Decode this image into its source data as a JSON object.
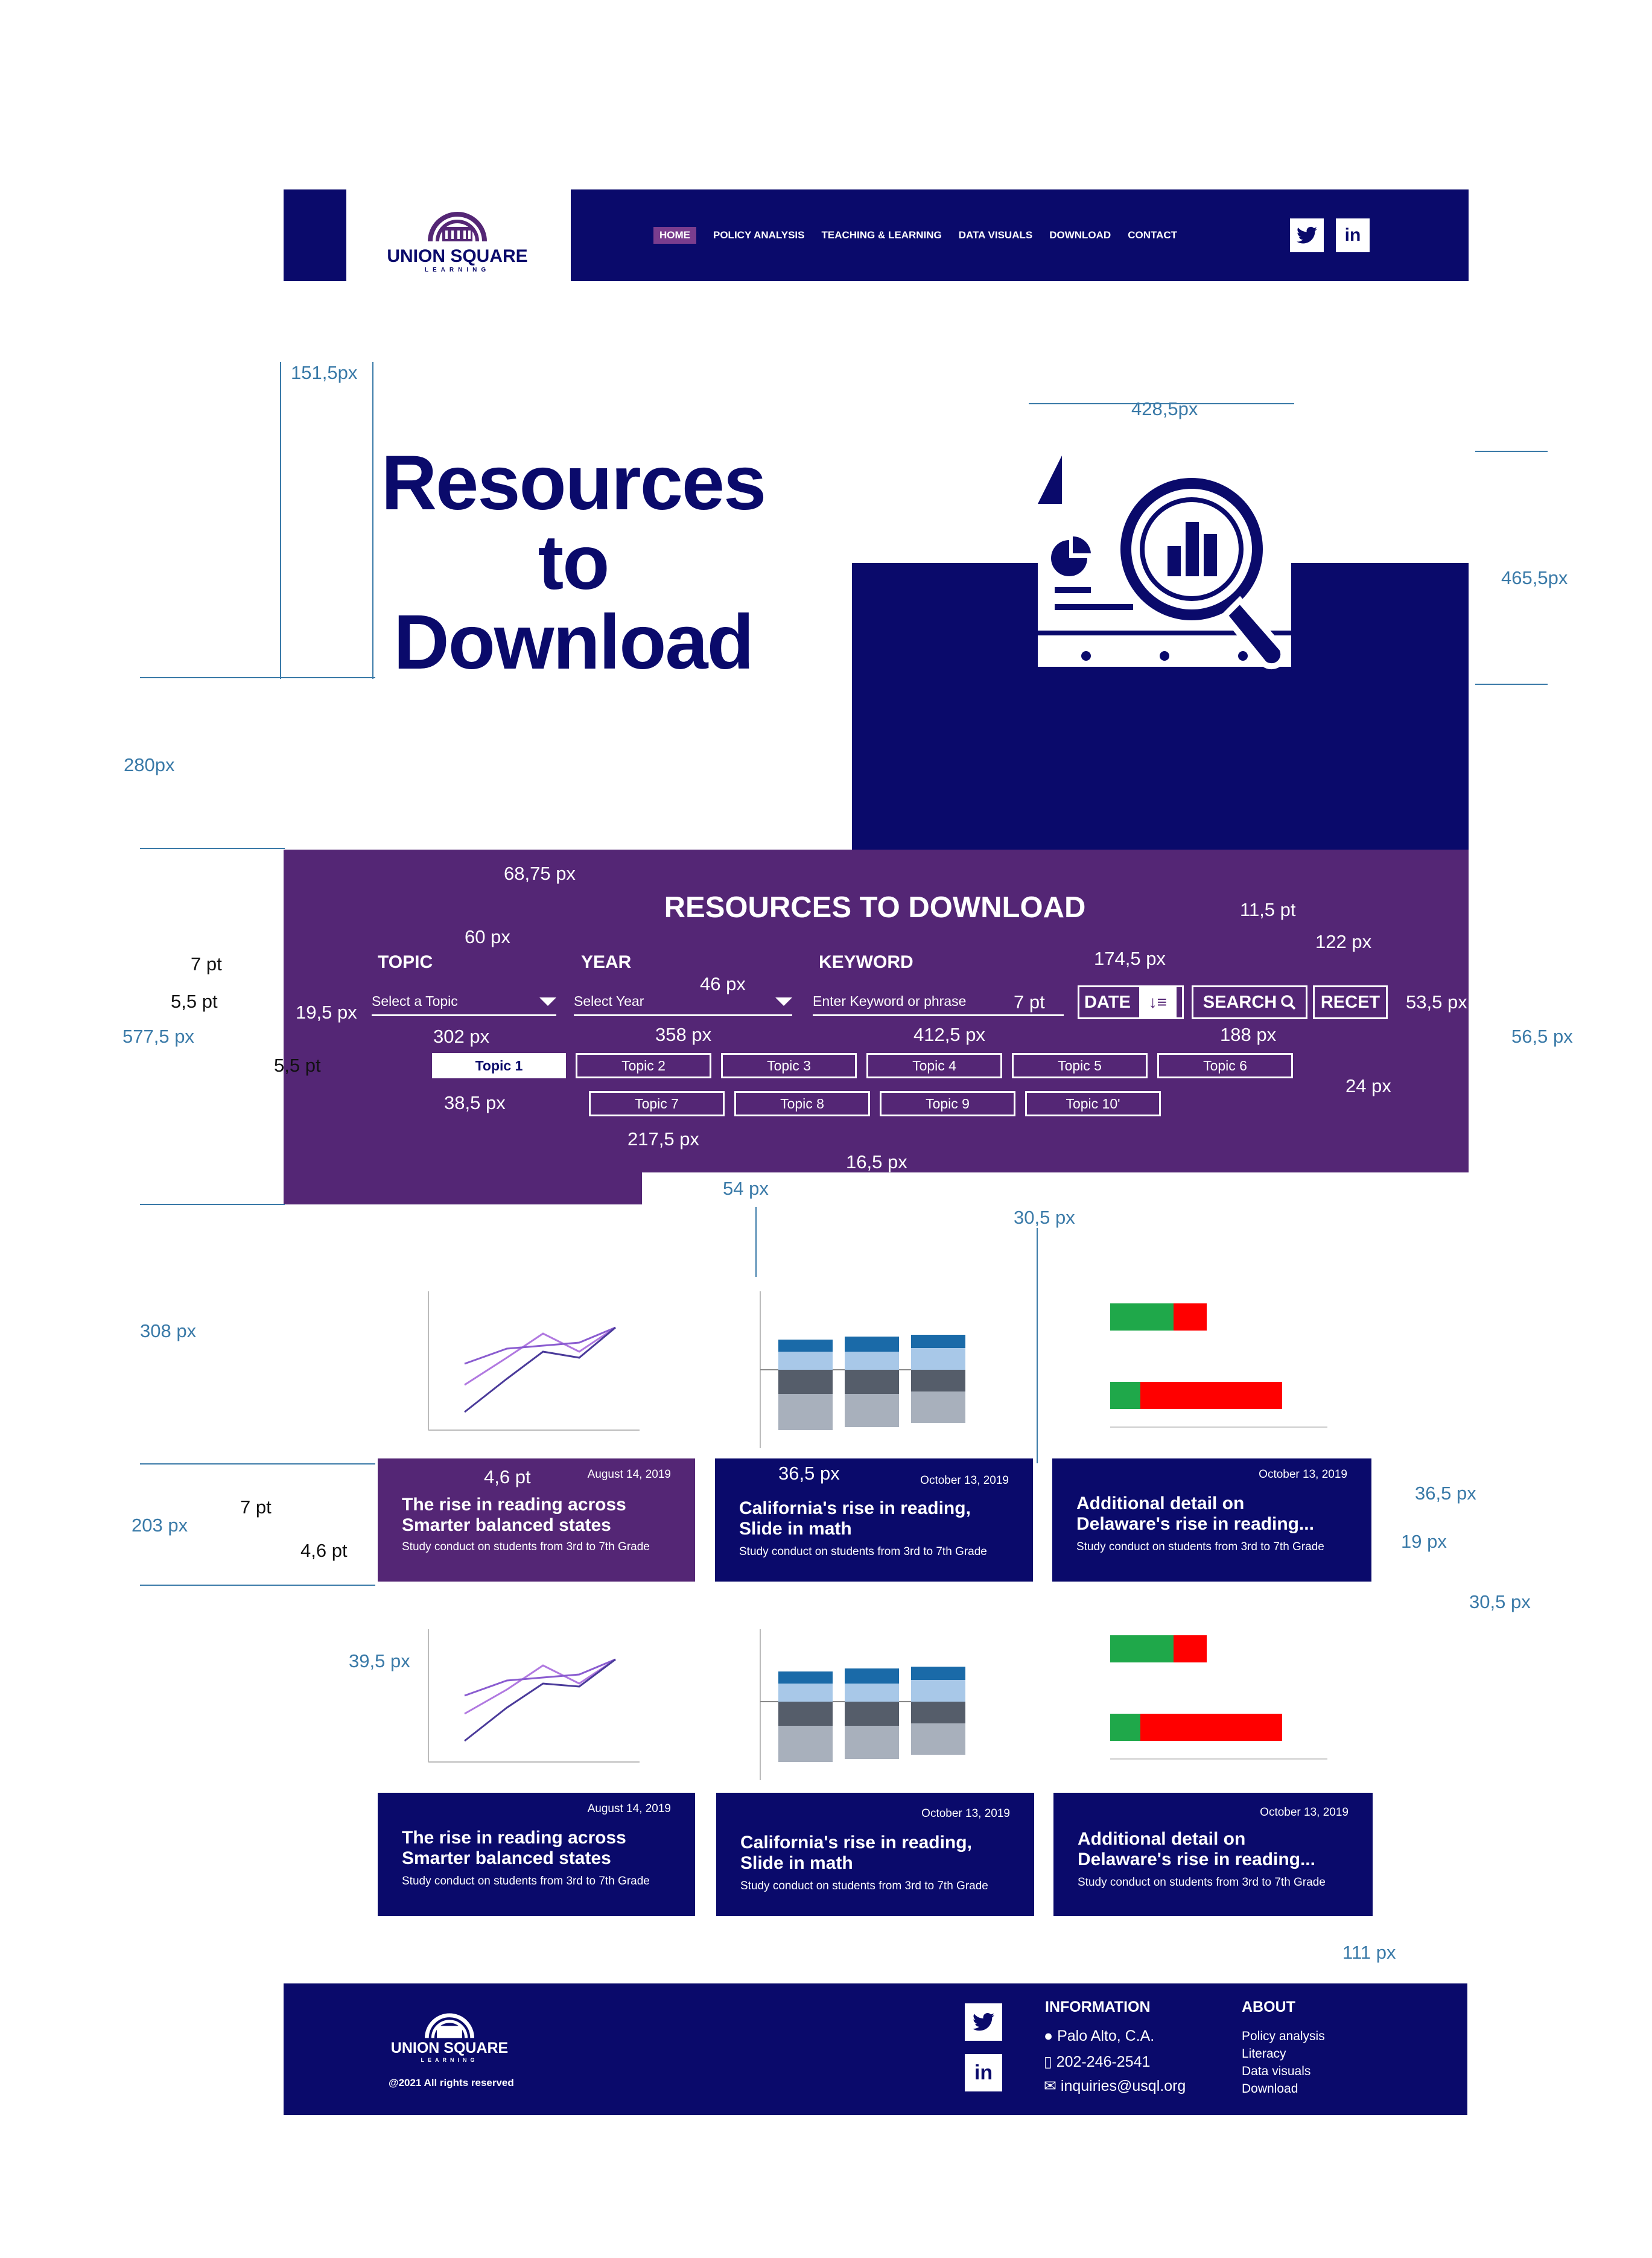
{
  "header": {
    "logo_name": "UNION SQUARE",
    "logo_sub": "LEARNING",
    "nav": [
      "HOME",
      "POLICY ANALYSIS",
      "TEACHING & LEARNING",
      "DATA VISUALS",
      "DOWNLOAD",
      "CONTACT"
    ],
    "social": [
      "twitter-icon",
      "linkedin-icon"
    ]
  },
  "hero": {
    "title_1": "Resources",
    "title_2": "to",
    "title_3": "Download"
  },
  "filters": {
    "title": "RESOURCES TO DOWNLOAD",
    "topic_label": "TOPIC",
    "topic_placeholder": "Select a Topic",
    "year_label": "YEAR",
    "year_placeholder": "Select Year",
    "keyword_label": "KEYWORD",
    "keyword_placeholder": "Enter Keyword or phrase",
    "date_button": "DATE",
    "search_button": "SEARCH",
    "reset_button": "RECET",
    "topics_row1": [
      "Topic 1",
      "Topic 2",
      "Topic 3",
      "Topic 4",
      "Topic 5",
      "Topic 6"
    ],
    "topics_row2": [
      "Topic 7",
      "Topic 8",
      "Topic 9",
      "Topic 10'"
    ]
  },
  "cards": [
    {
      "date": "August 14, 2019",
      "title_1": "The rise in reading across",
      "title_2": "Smarter balanced states",
      "subtitle": "Study conduct on students from 3rd to 7th Grade"
    },
    {
      "date": "October 13, 2019",
      "title_1": "California's rise in reading,",
      "title_2": "Slide in math",
      "subtitle": "Study conduct on students from 3rd to 7th Grade"
    },
    {
      "date": "October 13, 2019",
      "title_1": "Additional detail on",
      "title_2": "Delaware's rise in reading...",
      "subtitle": "Study conduct on students from 3rd to 7th Grade"
    },
    {
      "date": "August 14, 2019",
      "title_1": "The rise in reading across",
      "title_2": "Smarter balanced states",
      "subtitle": "Study conduct on students from 3rd to 7th Grade"
    },
    {
      "date": "October 13, 2019",
      "title_1": "California's rise in reading,",
      "title_2": "Slide in math",
      "subtitle": "Study conduct on students from 3rd to 7th Grade"
    },
    {
      "date": "October 13, 2019",
      "title_1": "Additional detail on",
      "title_2": "Delaware's rise in reading...",
      "subtitle": "Study conduct on students from 3rd to 7th Grade"
    }
  ],
  "footer": {
    "logo_name": "UNION SQUARE",
    "logo_sub": "LEARNING",
    "copyright": "@2021 All rights reserved",
    "info_heading": "INFORMATION",
    "location": "Palo Alto, C.A.",
    "phone": "202-246-2541",
    "email": "inquiries@usql.org",
    "about_heading": "ABOUT",
    "about_links": [
      "Policy analysis",
      "Literacy",
      "Data visuals",
      "Download"
    ]
  },
  "annotations": {
    "a1": "151,5px",
    "a2": "428,5px",
    "a3": "465,5px",
    "a4": "280px",
    "a5": "68,75 px",
    "a6": "60 px",
    "a7": "7 pt",
    "a8": "5,5 pt",
    "a9": "19,5 px",
    "a10": "577,5 px",
    "a11": "5,5 pt",
    "a12": "302 px",
    "a13": "46 px",
    "a14": "358 px",
    "a15": "7 pt",
    "a16": "412,5 px",
    "a17": "174,5 px",
    "a18": "11,5 pt",
    "a19": "122 px",
    "a20": "53,5 px",
    "a21": "56,5 px",
    "a22": "188 px",
    "a23": "24 px",
    "a24": "38,5 px",
    "a25": "217,5 px",
    "a26": "16,5 px",
    "a27": "54 px",
    "a28": "30,5 px",
    "a29": "308 px",
    "a30": "4,6 pt",
    "a31": "36,5 px",
    "a32": "7 pt",
    "a33": "203 px",
    "a34": "4,6 pt",
    "a35": "36,5 px",
    "a36": "19 px",
    "a37": "30,5 px",
    "a38": "39,5 px",
    "a39": "111 px"
  },
  "colors": {
    "navy": "#0a0a6b",
    "purple": "#542675",
    "accent_green": "#1fa84a",
    "accent_red": "#ff0000"
  }
}
